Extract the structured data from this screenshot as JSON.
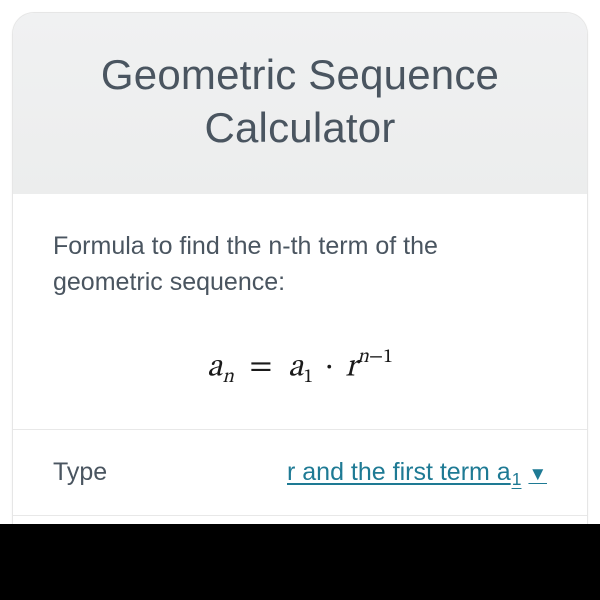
{
  "header": {
    "title": "Geometric Sequence Calculator"
  },
  "formula": {
    "label": "Formula to find the n-th term of the geometric sequence:",
    "parts": {
      "a": "a",
      "sub_n": "n",
      "eq": "=",
      "a1_a": "a",
      "a1_sub": "1",
      "dot": "·",
      "r": "r",
      "exp_n": "n",
      "exp_minus": "−",
      "exp_one": "1"
    }
  },
  "type_row": {
    "label": "Type",
    "selected_prefix": "r and the first term a",
    "selected_sub": "1",
    "caret": "▼"
  }
}
